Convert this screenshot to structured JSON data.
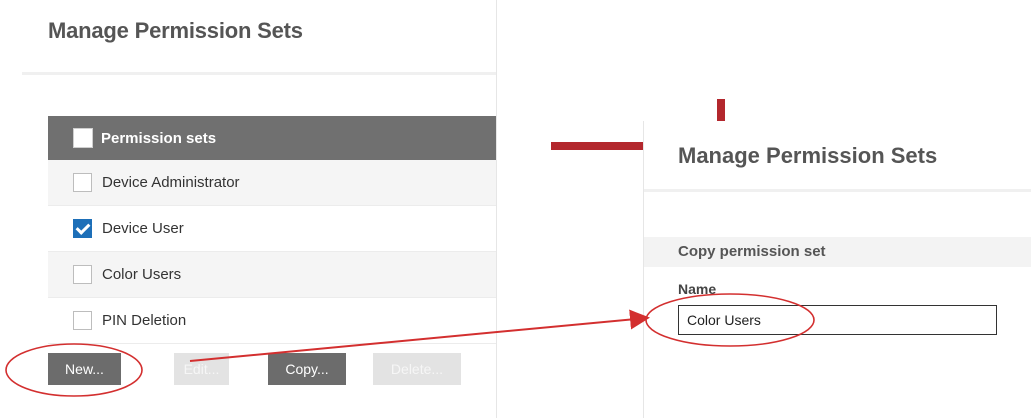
{
  "left": {
    "title": "Manage Permission Sets",
    "header_label": "Permission sets",
    "rows": [
      {
        "label": "Device Administrator",
        "checked": false
      },
      {
        "label": "Device User",
        "checked": true
      },
      {
        "label": "Color Users",
        "checked": false
      },
      {
        "label": "PIN Deletion",
        "checked": false
      }
    ],
    "buttons": {
      "new": "New...",
      "edit": "Edit...",
      "copy": "Copy...",
      "delete": "Delete..."
    }
  },
  "right": {
    "title": "Manage Permission Sets",
    "section_title": "Copy permission set",
    "name_label": "Name",
    "name_value": "Color Users"
  },
  "colors": {
    "annotation_red": "#b3272d",
    "checked_blue": "#1d6fb8",
    "header_gray": "#707070"
  }
}
